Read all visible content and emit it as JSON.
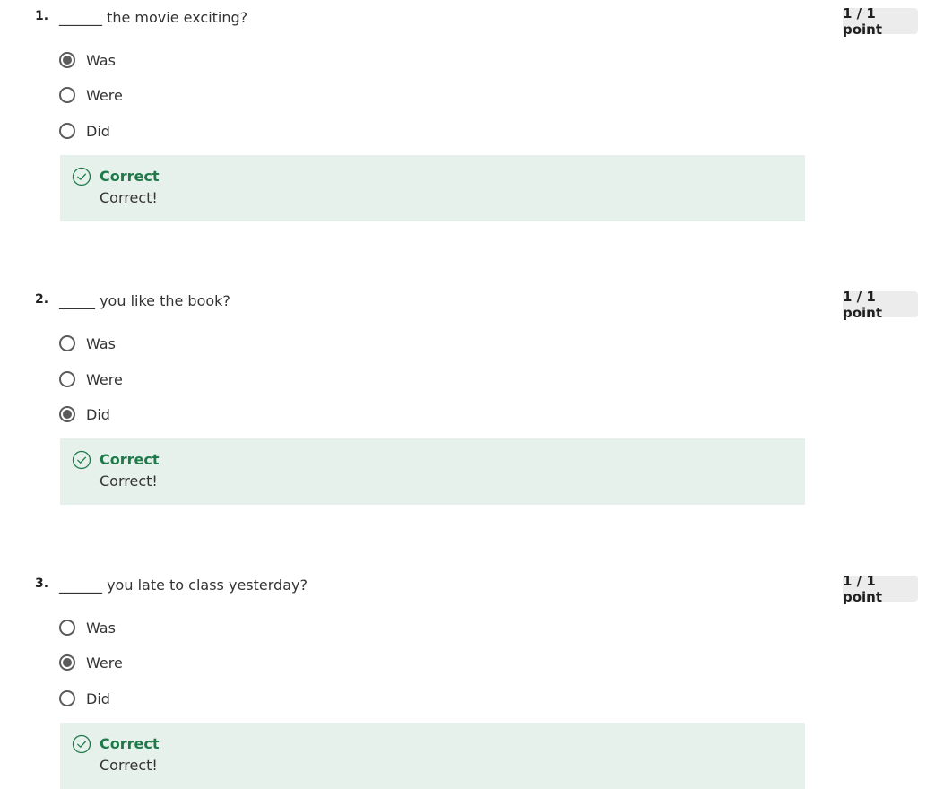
{
  "colors": {
    "correct_green": "#1f7a4a",
    "feedback_bg": "#e6f1ec",
    "badge_bg": "#ececec",
    "radio": "#5b5b5b"
  },
  "questions": [
    {
      "number": "1.",
      "text": "______ the movie exciting?",
      "points": "1 / 1 point",
      "options": [
        {
          "label": "Was",
          "selected": true
        },
        {
          "label": "Were",
          "selected": false
        },
        {
          "label": "Did",
          "selected": false
        }
      ],
      "feedback": {
        "title": "Correct",
        "text": "Correct!",
        "icon": "check-circle-icon"
      }
    },
    {
      "number": "2.",
      "text": "_____ you like the book?",
      "points": "1 / 1 point",
      "options": [
        {
          "label": "Was",
          "selected": false
        },
        {
          "label": "Were",
          "selected": false
        },
        {
          "label": "Did",
          "selected": true
        }
      ],
      "feedback": {
        "title": "Correct",
        "text": "Correct!",
        "icon": "check-circle-icon"
      }
    },
    {
      "number": "3.",
      "text": "______ you late to class yesterday?",
      "points": "1 / 1 point",
      "options": [
        {
          "label": "Was",
          "selected": false
        },
        {
          "label": "Were",
          "selected": true
        },
        {
          "label": "Did",
          "selected": false
        }
      ],
      "feedback": {
        "title": "Correct",
        "text": "Correct!",
        "icon": "check-circle-icon"
      }
    }
  ]
}
